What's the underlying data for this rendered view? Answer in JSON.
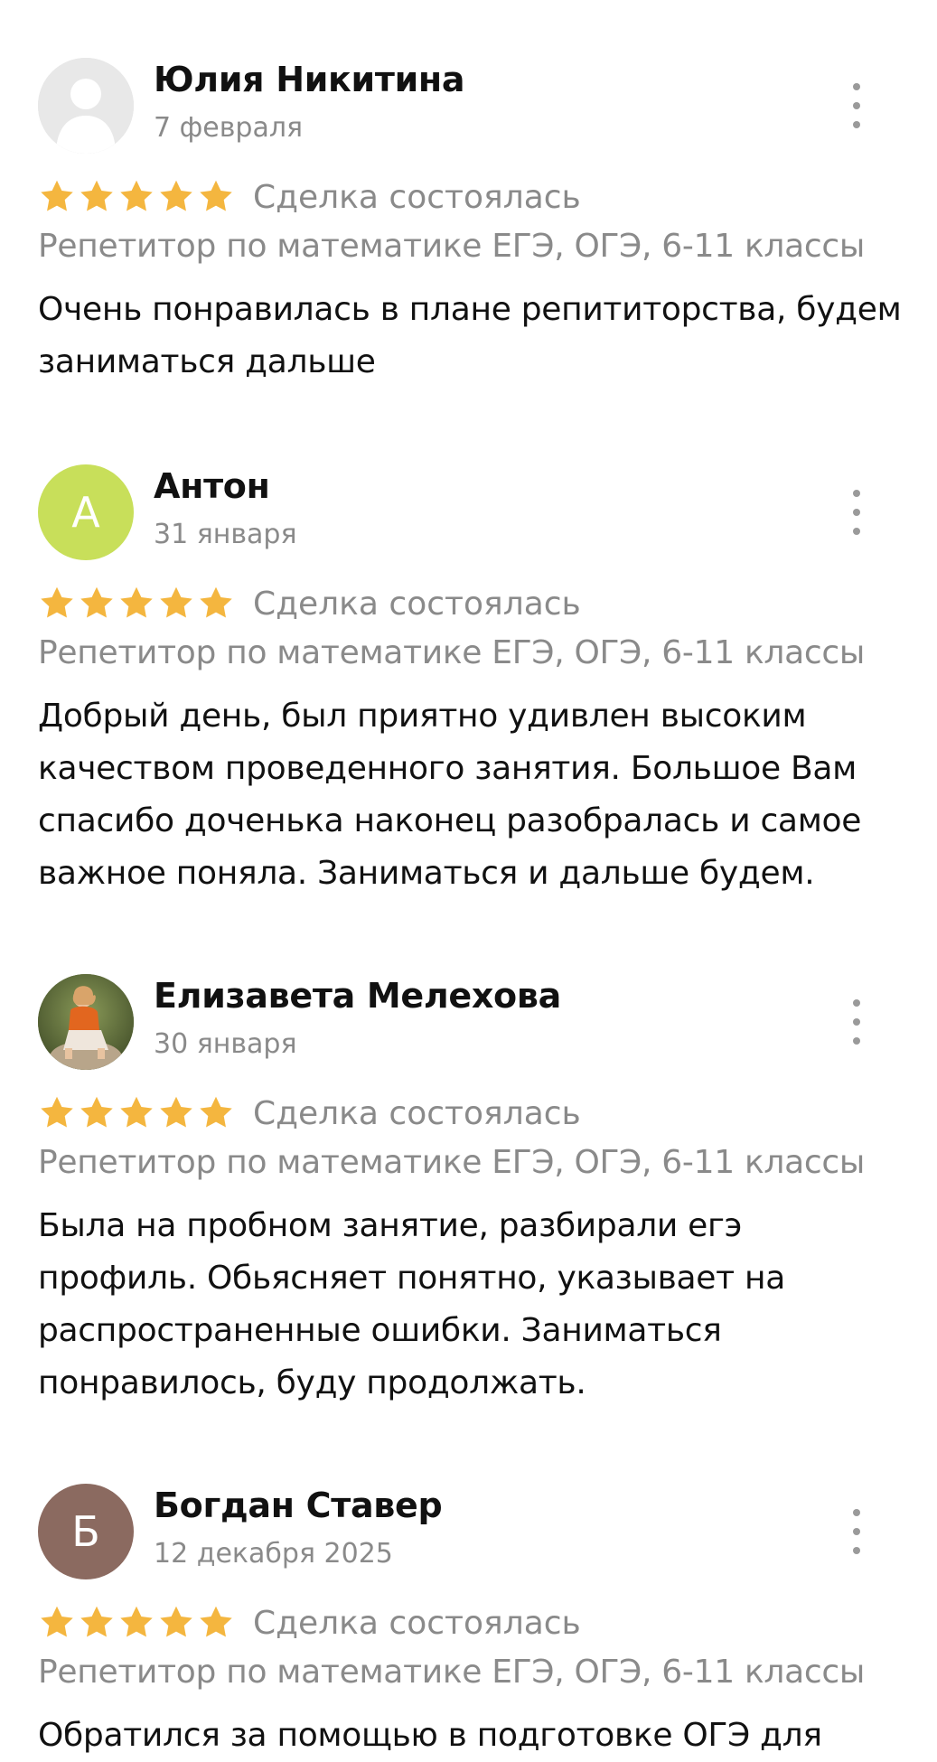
{
  "reviews": [
    {
      "name": "Юлия Никитина",
      "date": "7 февраля",
      "rating": 5,
      "status": "Сделка состоялась",
      "service": "Репетитор по математике ЕГЭ, ОГЭ, 6-11 классы",
      "text": "Очень понравилась в плане репититорства, будем заниматься дальше",
      "avatar": {
        "type": "placeholder-silhouette",
        "letter": "",
        "color": "#e6e6e6"
      }
    },
    {
      "name": "Антон",
      "date": "31 января",
      "rating": 5,
      "status": "Сделка состоялась",
      "service": "Репетитор по математике ЕГЭ, ОГЭ, 6-11 классы",
      "text": "Добрый день, был приятно удивлен высоким качеством проведенного занятия. Большое Вам спасибо доченька наконец разобралась и самое важное поняла. Заниматься и дальше будем.",
      "avatar": {
        "type": "letter",
        "letter": "А",
        "color": "#c8df5a"
      }
    },
    {
      "name": "Елизавета Мелехова",
      "date": "30 января",
      "rating": 5,
      "status": "Сделка состоялась",
      "service": "Репетитор по математике ЕГЭ, ОГЭ, 6-11 классы",
      "text": "Была на пробном занятие, разбирали егэ профиль. Обьясняет понятно, указывает на распространенные ошибки. Заниматься понравилось, буду продолжать.",
      "avatar": {
        "type": "photo",
        "letter": "",
        "color": "#5f6b3a"
      }
    },
    {
      "name": "Богдан Ставер",
      "date": "12 декабря 2025",
      "rating": 5,
      "status": "Сделка состоялась",
      "service": "Репетитор по математике ЕГЭ, ОГЭ, 6-11 классы",
      "text": "Обратился за помощью в подготовке ОГЭ для",
      "avatar": {
        "type": "letter",
        "letter": "Б",
        "color": "#8b6a60"
      }
    }
  ],
  "colors": {
    "star": "#f4b63f",
    "secondary_text": "#8a8a8a",
    "primary_text": "#111111",
    "menu_dots": "#9a9a9a"
  },
  "icons": {
    "star": "star-icon",
    "menu": "more-vertical-icon",
    "avatar_placeholder": "user-silhouette-icon"
  }
}
